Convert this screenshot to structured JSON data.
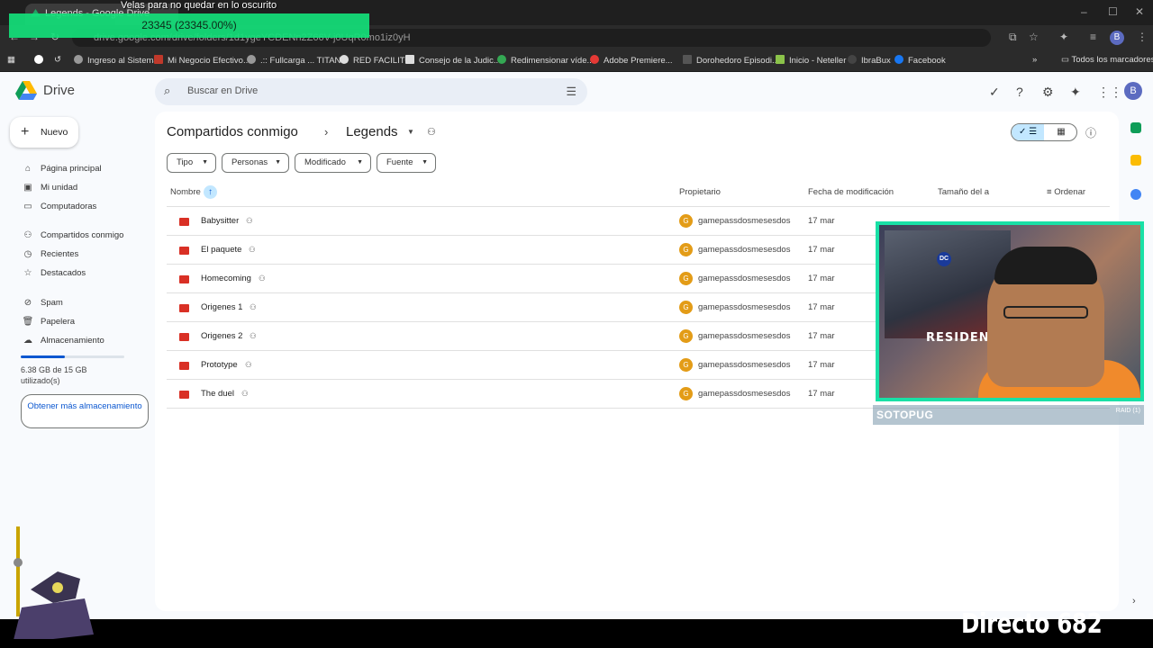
{
  "browser": {
    "tab_title": "Legends - Google Drive",
    "url": "drive.google.com/drive/folders/1d1ygeYCDENn2Z66V-j0UqR0mo1iz0yH",
    "profile_initial": "B",
    "bookmarks": [
      {
        "label": "",
        "color": "#ffffff"
      },
      {
        "label": "Ingreso al Sistema",
        "color": "#999999"
      },
      {
        "label": "Mi Negocio Efectivo...",
        "color": "#c0392b"
      },
      {
        "label": ".:: Fullcarga ... TITAN...",
        "color": "#999999"
      },
      {
        "label": "RED FACILITO",
        "color": "#dddddd"
      },
      {
        "label": "Consejo de la Judic...",
        "color": "#dddddd"
      },
      {
        "label": "Redimensionar víde...",
        "color": "#34a853"
      },
      {
        "label": "Adobe Premiere...",
        "color": "#e53935"
      },
      {
        "label": "Dorohedoro Episodi...",
        "color": "#333333"
      },
      {
        "label": "Inicio - Neteller",
        "color": "#8bc34a"
      },
      {
        "label": "IbraBux",
        "color": "#222222"
      },
      {
        "label": "Facebook",
        "color": "#1877f2"
      }
    ],
    "all_bookmarks": "Todos los marcadores"
  },
  "stream_overlay": {
    "title": "Velas para no quedar en lo oscurito",
    "progress": "23345 (23345.00%)",
    "cam_name": "SOTOPUG",
    "cam_badge": "RAID (1)",
    "directo": "Directo 682",
    "poster_text": "RESIDENT"
  },
  "drive": {
    "app_name": "Drive",
    "search_placeholder": "Buscar en Drive",
    "user_initial": "B",
    "new_button": "Nuevo",
    "nav": [
      "Página principal",
      "Mi unidad",
      "Computadoras",
      "Compartidos conmigo",
      "Recientes",
      "Destacados",
      "Spam",
      "Papelera",
      "Almacenamiento"
    ],
    "storage": {
      "text": "6.38 GB de 15 GB utilizado(s)",
      "used_fraction": 0.425
    },
    "get_more": "Obtener más almacenamiento",
    "breadcrumb": {
      "root": "Compartidos conmigo",
      "current": "Legends"
    },
    "filters": [
      "Tipo",
      "Personas",
      "Modificado",
      "Fuente"
    ],
    "columns": {
      "name": "Nombre",
      "owner": "Propietario",
      "modified": "Fecha de modificación",
      "size": "Tamaño del a",
      "sort": "Ordenar"
    },
    "files": [
      {
        "name": "Babysitter",
        "owner": "gamepassdosmesesdos",
        "owner_initial": "G",
        "modified": "17 mar"
      },
      {
        "name": "El paquete",
        "owner": "gamepassdosmesesdos",
        "owner_initial": "G",
        "modified": "17 mar"
      },
      {
        "name": "Homecoming",
        "owner": "gamepassdosmesesdos",
        "owner_initial": "G",
        "modified": "17 mar"
      },
      {
        "name": "Origenes 1",
        "owner": "gamepassdosmesesdos",
        "owner_initial": "G",
        "modified": "17 mar"
      },
      {
        "name": "Origenes 2",
        "owner": "gamepassdosmesesdos",
        "owner_initial": "G",
        "modified": "17 mar"
      },
      {
        "name": "Prototype",
        "owner": "gamepassdosmesesdos",
        "owner_initial": "G",
        "modified": "17 mar"
      },
      {
        "name": "The duel",
        "owner": "gamepassdosmesesdos",
        "owner_initial": "G",
        "modified": "17 mar"
      }
    ]
  },
  "colors": {
    "accent": "#0b57d0",
    "selected": "#c2e7ff",
    "folder": "#d93025",
    "cam_border": "#19e0a6",
    "overlay_green": "#14e07a"
  }
}
